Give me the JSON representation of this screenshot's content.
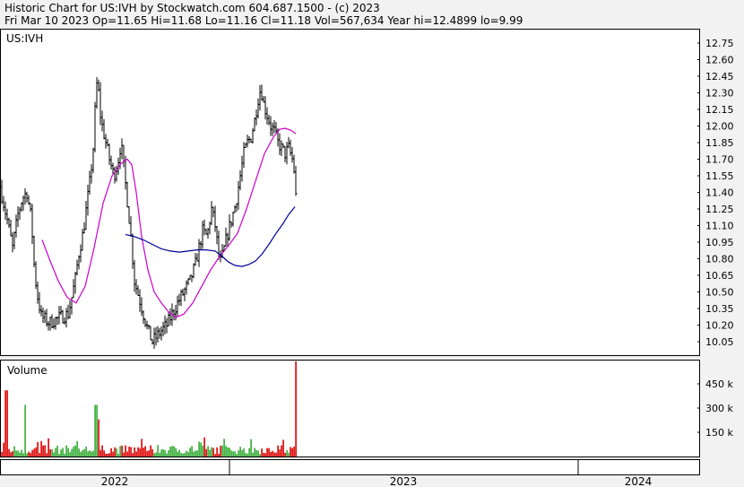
{
  "header": {
    "line1": "Historic Chart for US:IVH by Stockwatch.com 604.687.1500 - (c) 2023",
    "line2": "Fri Mar 10 2023   Op=11.65   Hi=11.68   Lo=11.16   Cl=11.18   Vol=567,634   Year hi=12.4899   lo=9.99"
  },
  "chart_data": [
    {
      "type": "bar",
      "subtype": "ohlc",
      "symbol_label": "US:IVH",
      "ylim": [
        9.9,
        12.82
      ],
      "yticks": [
        "12.75",
        "12.60",
        "12.45",
        "12.30",
        "12.15",
        "12.00",
        "11.85",
        "11.70",
        "11.55",
        "11.40",
        "11.25",
        "11.10",
        "10.95",
        "10.80",
        "10.65",
        "10.50",
        "10.35",
        "10.20",
        "10.05"
      ],
      "price_path": [
        [
          0,
          11.45
        ],
        [
          8,
          11.15
        ],
        [
          14,
          10.9
        ],
        [
          20,
          11.2
        ],
        [
          25,
          11.35
        ],
        [
          30,
          11.4
        ],
        [
          35,
          11.15
        ],
        [
          38,
          10.75
        ],
        [
          41,
          10.5
        ],
        [
          46,
          10.28
        ],
        [
          55,
          10.22
        ],
        [
          62,
          10.25
        ],
        [
          70,
          10.28
        ],
        [
          76,
          10.3
        ],
        [
          80,
          10.45
        ],
        [
          84,
          10.62
        ],
        [
          88,
          10.85
        ],
        [
          93,
          11.05
        ],
        [
          97,
          11.3
        ],
        [
          101,
          11.55
        ],
        [
          104,
          11.8
        ],
        [
          107,
          12.3
        ],
        [
          109,
          12.45
        ],
        [
          111,
          12.15
        ],
        [
          114,
          12.0
        ],
        [
          118,
          11.85
        ],
        [
          122,
          11.7
        ],
        [
          127,
          11.55
        ],
        [
          131,
          11.65
        ],
        [
          135,
          11.85
        ],
        [
          139,
          11.55
        ],
        [
          143,
          11.25
        ],
        [
          146,
          11.0
        ],
        [
          150,
          10.6
        ],
        [
          155,
          10.45
        ],
        [
          160,
          10.3
        ],
        [
          165,
          10.15
        ],
        [
          170,
          10.05
        ],
        [
          175,
          10.1
        ],
        [
          180,
          10.15
        ],
        [
          186,
          10.2
        ],
        [
          192,
          10.3
        ],
        [
          198,
          10.4
        ],
        [
          205,
          10.5
        ],
        [
          212,
          10.6
        ],
        [
          218,
          10.75
        ],
        [
          222,
          10.9
        ],
        [
          226,
          11.05
        ],
        [
          231,
          11.0
        ],
        [
          236,
          11.25
        ],
        [
          240,
          11.1
        ],
        [
          245,
          10.75
        ],
        [
          249,
          10.85
        ],
        [
          253,
          11.0
        ],
        [
          258,
          11.15
        ],
        [
          263,
          11.3
        ],
        [
          268,
          11.55
        ],
        [
          272,
          11.75
        ],
        [
          276,
          11.85
        ],
        [
          280,
          11.9
        ],
        [
          284,
          12.05
        ],
        [
          288,
          12.25
        ],
        [
          291,
          12.35
        ],
        [
          294,
          12.2
        ],
        [
          298,
          12.1
        ],
        [
          302,
          12.0
        ],
        [
          306,
          11.95
        ],
        [
          310,
          11.85
        ],
        [
          314,
          11.8
        ],
        [
          318,
          11.75
        ],
        [
          322,
          11.8
        ],
        [
          326,
          11.7
        ],
        [
          329,
          11.55
        ],
        [
          331,
          11.18
        ]
      ],
      "series": [
        {
          "name": "",
          "color": "#cc00cc",
          "kind": "moving-average-short",
          "path": [
            [
              47,
              10.97
            ],
            [
              55,
              10.8
            ],
            [
              65,
              10.6
            ],
            [
              75,
              10.45
            ],
            [
              85,
              10.4
            ],
            [
              95,
              10.55
            ],
            [
              105,
              10.9
            ],
            [
              115,
              11.3
            ],
            [
              125,
              11.55
            ],
            [
              135,
              11.66
            ],
            [
              142,
              11.7
            ],
            [
              147,
              11.65
            ],
            [
              152,
              11.4
            ],
            [
              158,
              11.0
            ],
            [
              165,
              10.7
            ],
            [
              172,
              10.5
            ],
            [
              180,
              10.4
            ],
            [
              188,
              10.32
            ],
            [
              196,
              10.27
            ],
            [
              205,
              10.3
            ],
            [
              215,
              10.4
            ],
            [
              225,
              10.55
            ],
            [
              235,
              10.7
            ],
            [
              245,
              10.82
            ],
            [
              255,
              10.92
            ],
            [
              265,
              11.03
            ],
            [
              275,
              11.25
            ],
            [
              285,
              11.5
            ],
            [
              295,
              11.75
            ],
            [
              305,
              11.9
            ],
            [
              312,
              11.97
            ],
            [
              318,
              11.98
            ],
            [
              325,
              11.96
            ],
            [
              330,
              11.93
            ]
          ]
        },
        {
          "name": "",
          "color": "#000099",
          "kind": "moving-average-long",
          "path": [
            [
              140,
              11.02
            ],
            [
              150,
              11.0
            ],
            [
              160,
              10.97
            ],
            [
              170,
              10.93
            ],
            [
              180,
              10.89
            ],
            [
              190,
              10.87
            ],
            [
              200,
              10.86
            ],
            [
              210,
              10.87
            ],
            [
              220,
              10.88
            ],
            [
              230,
              10.88
            ],
            [
              240,
              10.87
            ],
            [
              248,
              10.82
            ],
            [
              255,
              10.77
            ],
            [
              262,
              10.74
            ],
            [
              270,
              10.73
            ],
            [
              278,
              10.75
            ],
            [
              285,
              10.78
            ],
            [
              292,
              10.84
            ],
            [
              300,
              10.93
            ],
            [
              308,
              11.03
            ],
            [
              316,
              11.12
            ],
            [
              322,
              11.2
            ],
            [
              329,
              11.27
            ]
          ]
        }
      ]
    },
    {
      "type": "bar",
      "subtype": "volume",
      "label": "Volume",
      "ylim": [
        0,
        590
      ],
      "yticks": [
        "450 k",
        "300 k",
        "150 k"
      ],
      "colors": {
        "up": "#33aa33",
        "down": "#dd0000"
      },
      "spikes": [
        [
          7,
          410
        ],
        [
          28,
          320
        ],
        [
          107,
          320
        ],
        [
          110,
          230
        ],
        [
          330,
          590
        ]
      ]
    }
  ],
  "time_axis": {
    "years": [
      {
        "label": "2022"
      },
      {
        "label": "2023"
      },
      {
        "label": "2024"
      }
    ]
  }
}
